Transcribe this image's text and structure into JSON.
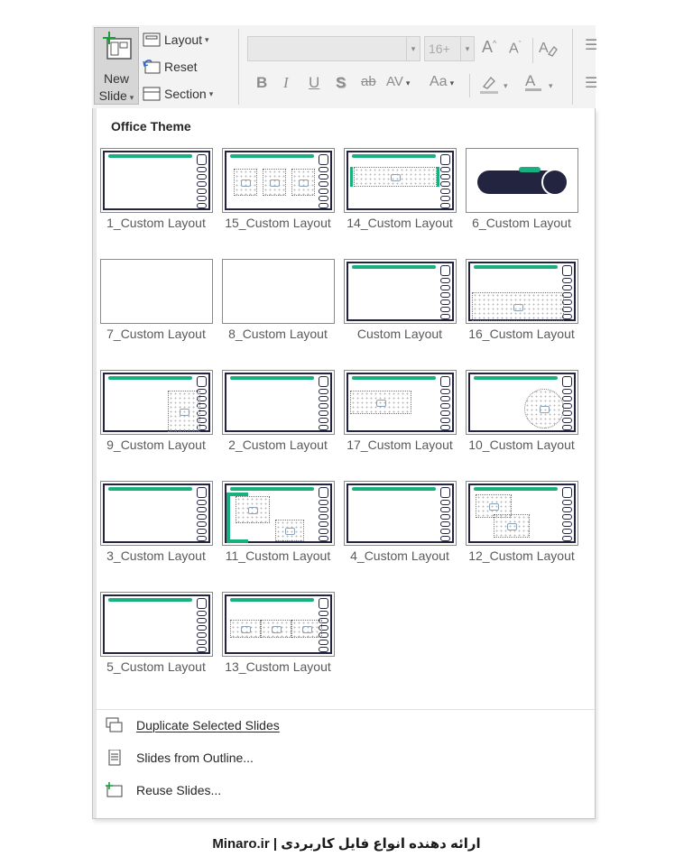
{
  "ribbon": {
    "new_slide_line1": "New",
    "new_slide_line2": "Slide",
    "layout_label": "Layout",
    "reset_label": "Reset",
    "section_label": "Section",
    "font_name_value": "",
    "font_size_value": "16+",
    "buttons": {
      "bold": "B",
      "italic": "I",
      "underline": "U",
      "shadow": "S",
      "strike": "ab",
      "spacing": "AV",
      "change_case": "Aa",
      "grow_font": "A",
      "shrink_font": "A",
      "font_color": "A"
    }
  },
  "gallery": {
    "theme_title": "Office Theme",
    "layouts": [
      {
        "label": "1_Custom Layout",
        "style": "frame"
      },
      {
        "label": "15_Custom Layout",
        "style": "three-boxes"
      },
      {
        "label": "14_Custom Layout",
        "style": "banner"
      },
      {
        "label": "6_Custom Layout",
        "style": "pill"
      },
      {
        "label": "7_Custom Layout",
        "style": "plain"
      },
      {
        "label": "8_Custom Layout",
        "style": "plain"
      },
      {
        "label": "Custom Layout",
        "style": "frame"
      },
      {
        "label": "16_Custom Layout",
        "style": "bottom-fill"
      },
      {
        "label": "9_Custom Layout",
        "style": "right-box"
      },
      {
        "label": "2_Custom Layout",
        "style": "frame"
      },
      {
        "label": "17_Custom Layout",
        "style": "left-box"
      },
      {
        "label": "10_Custom Layout",
        "style": "circle"
      },
      {
        "label": "3_Custom Layout",
        "style": "frame"
      },
      {
        "label": "11_Custom Layout",
        "style": "bracket-boxes"
      },
      {
        "label": "4_Custom Layout",
        "style": "frame"
      },
      {
        "label": "12_Custom Layout",
        "style": "stacked-boxes"
      },
      {
        "label": "5_Custom Layout",
        "style": "frame"
      },
      {
        "label": "13_Custom Layout",
        "style": "three-wide"
      }
    ]
  },
  "menu": {
    "duplicate": "Duplicate Selected Slides",
    "outline": "Slides from Outline...",
    "reuse": "Reuse Slides..."
  },
  "footer": {
    "text": "Minaro.ir | ارائه دهنده انواع فایل کاربردی"
  },
  "colors": {
    "accent_green": "#1aaf7e",
    "dark_navy": "#23243f"
  }
}
